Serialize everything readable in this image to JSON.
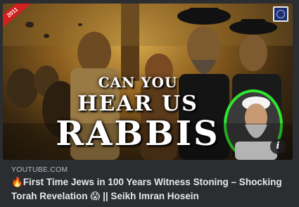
{
  "thumbnail": {
    "ribbon_text": "2011",
    "overlay_line1": "CAN YOU",
    "overlay_line2": "HEAR US",
    "overlay_line3": "RABBIS",
    "info_glyph": "i"
  },
  "source_label": "YOUTUBE.COM",
  "headline": {
    "fire_emoji": "🔥",
    "text_part1": "First Time Jews in 100 Years Witness Stoning – Shocking Torah Revelation ",
    "scream_emoji": "😱",
    "text_part2": " || Seikh Imran Hosein"
  },
  "colors": {
    "card_bg": "#2b2d31",
    "source_text": "#b5bac1",
    "headline_text": "#e6e8eb",
    "ribbon": "#d21f1f",
    "highlight_green": "#2ee62e"
  }
}
